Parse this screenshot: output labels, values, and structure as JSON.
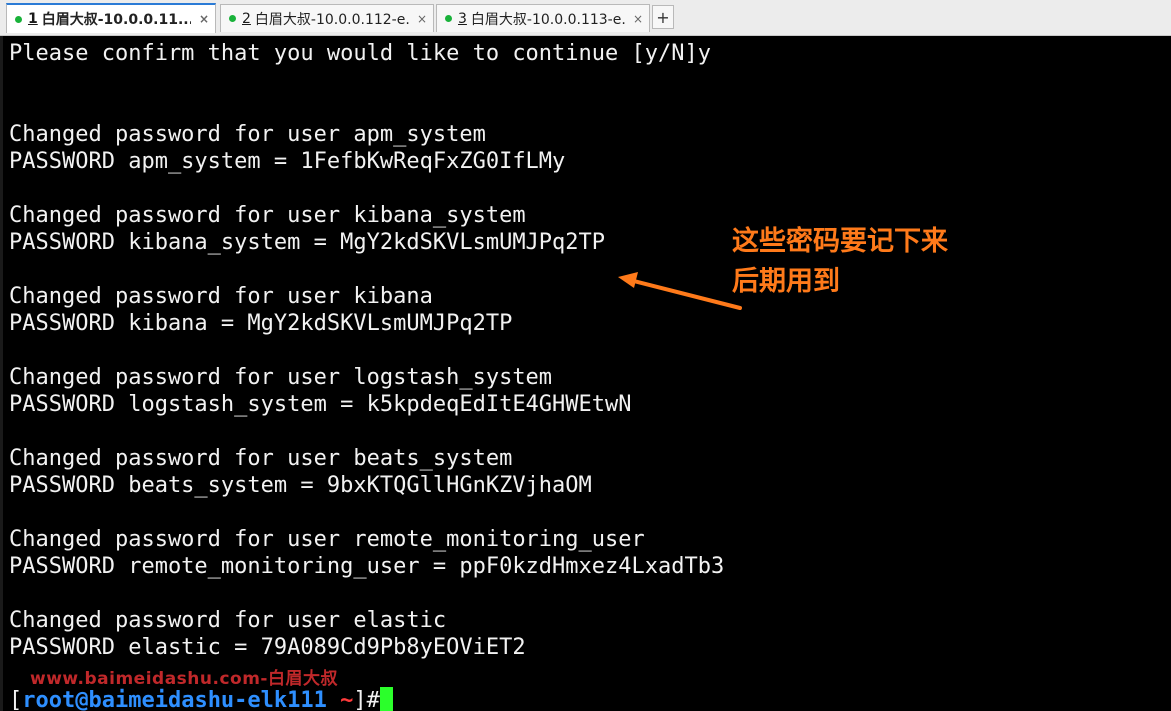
{
  "tabs": [
    {
      "number": "1",
      "title": "白眉大叔-10.0.0.11...",
      "active": true
    },
    {
      "number": "2",
      "title": "白眉大叔-10.0.0.112-e...",
      "active": false
    },
    {
      "number": "3",
      "title": "白眉大叔-10.0.0.113-e...",
      "active": false
    }
  ],
  "tab_close_glyph": "×",
  "tab_add_glyph": "+",
  "terminal": {
    "lines": [
      "Please confirm that you would like to continue [y/N]y",
      "",
      "",
      "Changed password for user apm_system",
      "PASSWORD apm_system = 1FefbKwReqFxZG0IfLMy",
      "",
      "Changed password for user kibana_system",
      "PASSWORD kibana_system = MgY2kdSKVLsmUMJPq2TP",
      "",
      "Changed password for user kibana",
      "PASSWORD kibana = MgY2kdSKVLsmUMJPq2TP",
      "",
      "Changed password for user logstash_system",
      "PASSWORD logstash_system = k5kpdeqEdItE4GHWEtwN",
      "",
      "Changed password for user beats_system",
      "PASSWORD beats_system = 9bxKTQGllHGnKZVjhaOM",
      "",
      "Changed password for user remote_monitoring_user",
      "PASSWORD remote_monitoring_user = ppF0kzdHmxez4LxadTb3",
      "",
      "Changed password for user elastic",
      "PASSWORD elastic = 79A089Cd9Pb8yEOViET2"
    ],
    "prompt": {
      "open": "[",
      "user": "root",
      "at": "@",
      "host": "baimeidashu-elk111",
      "path": "~",
      "close": "]#"
    }
  },
  "annotation": {
    "line1": "这些密码要记下来",
    "line2": "后期用到",
    "color": "#ff7a1a"
  },
  "watermark": "www.baimeidashu.com-白眉大叔",
  "colors": {
    "terminal_bg": "#000000",
    "terminal_fg": "#f2f2f2",
    "prompt_user": "#2e8fff",
    "prompt_path": "#ff3b3b",
    "cursor": "#2bff2b",
    "tab_active_accent": "#2b7bd6",
    "status_dot": "#19b23a"
  }
}
